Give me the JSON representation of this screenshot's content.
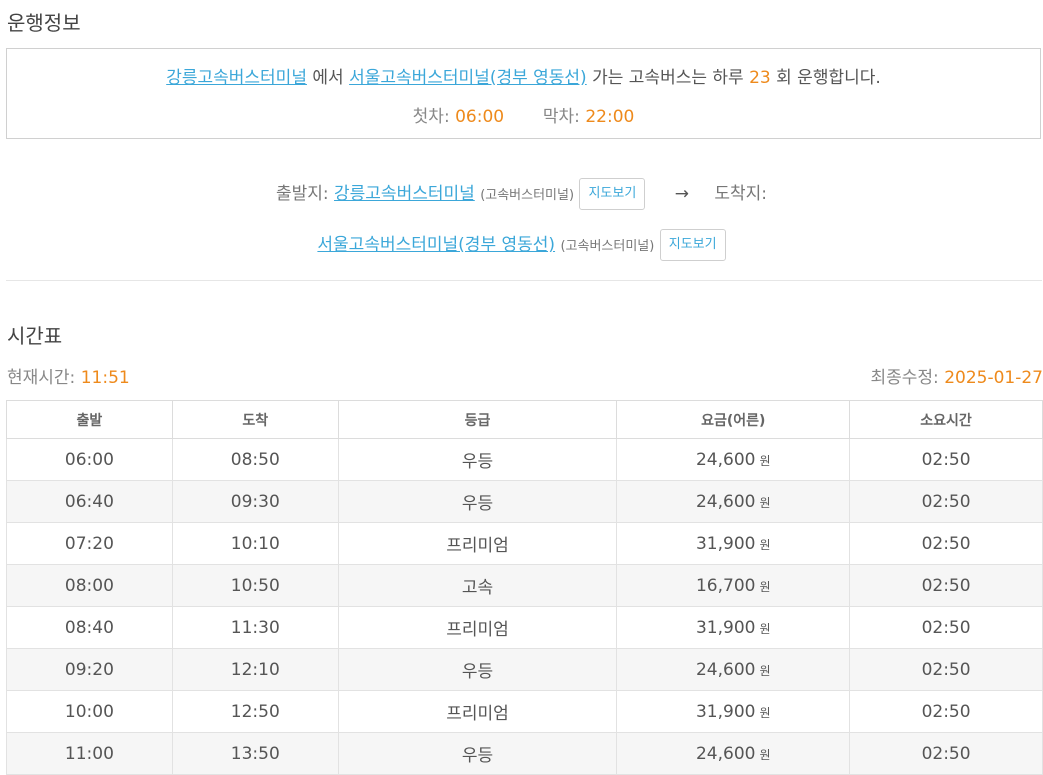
{
  "info": {
    "title": "운행정보",
    "origin": "강릉고속버스터미널",
    "from_text": "에서",
    "destination": "서울고속버스터미널(경부 영동선)",
    "mid_text": "가는 고속버스는 하루",
    "daily_count": "23",
    "tail_text": "회 운행합니다.",
    "first_label": "첫차:",
    "first_time": "06:00",
    "last_label": "막차:",
    "last_time": "22:00"
  },
  "route": {
    "departure_label": "출발지:",
    "departure_name": "강릉고속버스터미널",
    "departure_type": "(고속버스터미널)",
    "arrow": "→",
    "arrival_label": "도착지:",
    "arrival_name": "서울고속버스터미널(경부 영동선)",
    "arrival_type": "(고속버스터미널)",
    "map_button": "지도보기"
  },
  "timetable": {
    "title": "시간표",
    "current_label": "현재시간:",
    "current_time": "11:51",
    "updated_label": "최종수정:",
    "updated_date": "2025-01-27",
    "currency": "원",
    "columns": [
      "출발",
      "도착",
      "등급",
      "요금(어른)",
      "소요시간"
    ],
    "rows": [
      {
        "depart": "06:00",
        "arrive": "08:50",
        "grade": "우등",
        "fare": "24,600",
        "duration": "02:50"
      },
      {
        "depart": "06:40",
        "arrive": "09:30",
        "grade": "우등",
        "fare": "24,600",
        "duration": "02:50"
      },
      {
        "depart": "07:20",
        "arrive": "10:10",
        "grade": "프리미엄",
        "fare": "31,900",
        "duration": "02:50"
      },
      {
        "depart": "08:00",
        "arrive": "10:50",
        "grade": "고속",
        "fare": "16,700",
        "duration": "02:50"
      },
      {
        "depart": "08:40",
        "arrive": "11:30",
        "grade": "프리미엄",
        "fare": "31,900",
        "duration": "02:50"
      },
      {
        "depart": "09:20",
        "arrive": "12:10",
        "grade": "우등",
        "fare": "24,600",
        "duration": "02:50"
      },
      {
        "depart": "10:00",
        "arrive": "12:50",
        "grade": "프리미엄",
        "fare": "31,900",
        "duration": "02:50"
      },
      {
        "depart": "11:00",
        "arrive": "13:50",
        "grade": "우등",
        "fare": "24,600",
        "duration": "02:50"
      }
    ]
  }
}
